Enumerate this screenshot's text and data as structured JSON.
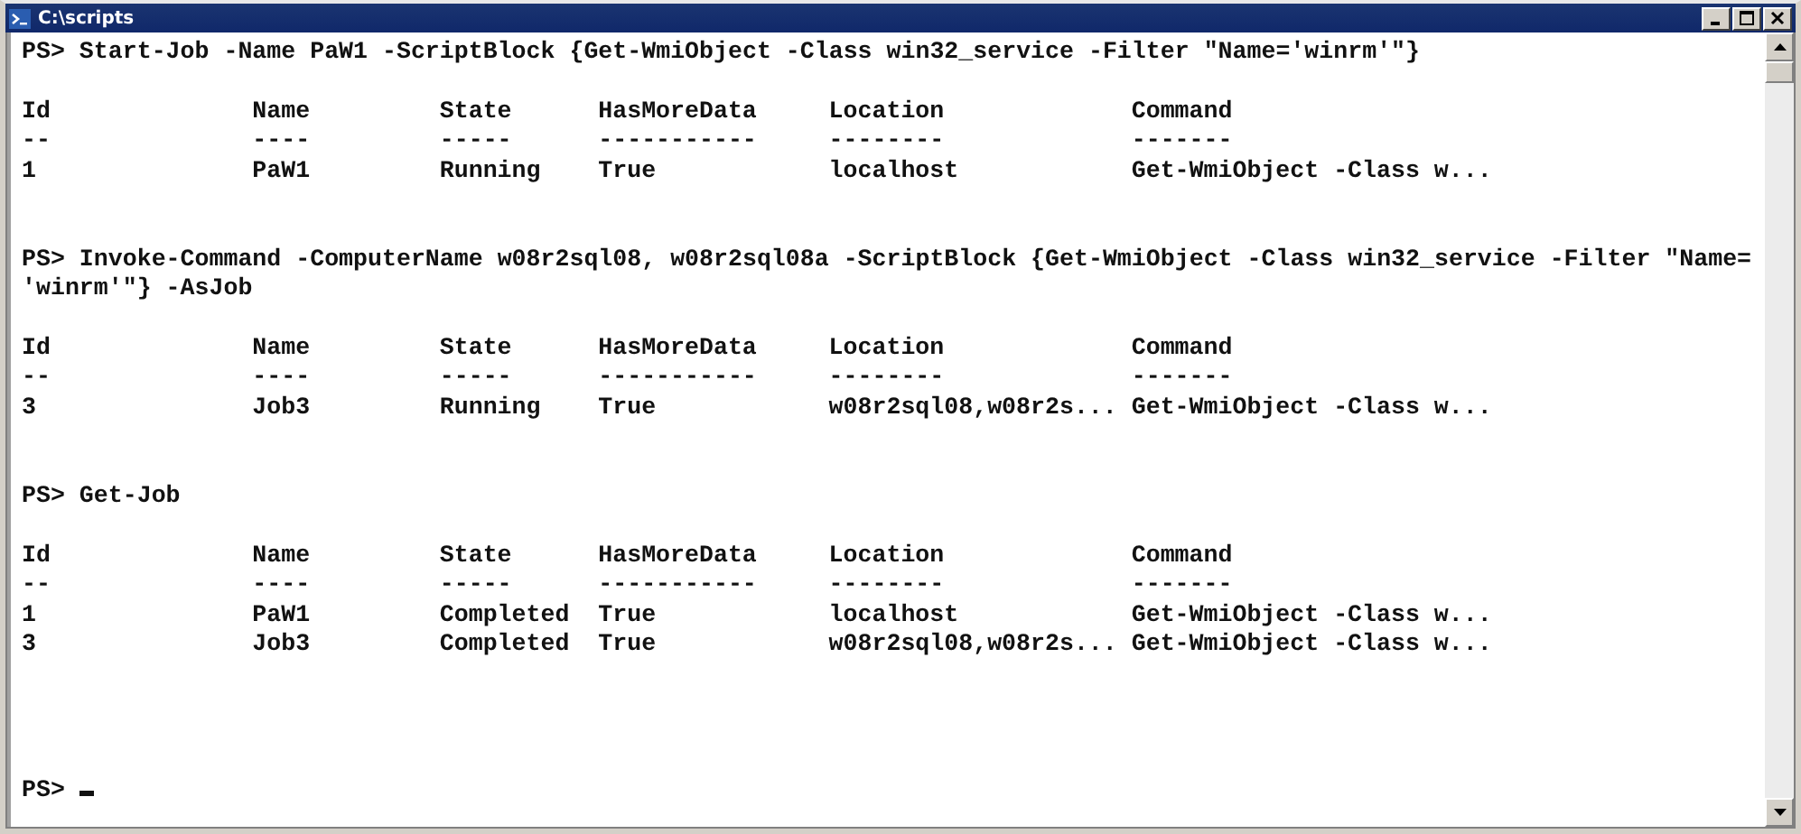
{
  "window": {
    "title": "C:\\scripts"
  },
  "console": [
    {
      "kind": "command",
      "lines": [
        "PS> Start-Job -Name PaW1 -ScriptBlock {Get-WmiObject -Class win32_service -Filter \"Name='winrm'\"}"
      ]
    },
    {
      "kind": "table",
      "columns": [
        {
          "label": "Id",
          "rule": "--"
        },
        {
          "label": "Name",
          "rule": "----"
        },
        {
          "label": "State",
          "rule": "-----"
        },
        {
          "label": "HasMoreData",
          "rule": "-----------"
        },
        {
          "label": "Location",
          "rule": "--------"
        },
        {
          "label": "Command",
          "rule": "-------"
        }
      ],
      "rows": [
        [
          "1",
          "PaW1",
          "Running",
          "True",
          "localhost",
          "Get-WmiObject -Class w..."
        ]
      ]
    },
    {
      "kind": "command",
      "lines": [
        "PS> Invoke-Command -ComputerName w08r2sql08, w08r2sql08a -ScriptBlock {Get-WmiObject -Class win32_service -Filter \"Name=",
        "'winrm'\"} -AsJob"
      ]
    },
    {
      "kind": "table",
      "columns": [
        {
          "label": "Id",
          "rule": "--"
        },
        {
          "label": "Name",
          "rule": "----"
        },
        {
          "label": "State",
          "rule": "-----"
        },
        {
          "label": "HasMoreData",
          "rule": "-----------"
        },
        {
          "label": "Location",
          "rule": "--------"
        },
        {
          "label": "Command",
          "rule": "-------"
        }
      ],
      "rows": [
        [
          "3",
          "Job3",
          "Running",
          "True",
          "w08r2sql08,w08r2s...",
          "Get-WmiObject -Class w..."
        ]
      ]
    },
    {
      "kind": "command",
      "lines": [
        "PS> Get-Job"
      ]
    },
    {
      "kind": "table",
      "columns": [
        {
          "label": "Id",
          "rule": "--"
        },
        {
          "label": "Name",
          "rule": "----"
        },
        {
          "label": "State",
          "rule": "-----"
        },
        {
          "label": "HasMoreData",
          "rule": "-----------"
        },
        {
          "label": "Location",
          "rule": "--------"
        },
        {
          "label": "Command",
          "rule": "-------"
        }
      ],
      "rows": [
        [
          "1",
          "PaW1",
          "Completed",
          "True",
          "localhost",
          "Get-WmiObject -Class w..."
        ],
        [
          "3",
          "Job3",
          "Completed",
          "True",
          "w08r2sql08,w08r2s...",
          "Get-WmiObject -Class w..."
        ]
      ]
    },
    {
      "kind": "prompt",
      "text": "PS>"
    }
  ]
}
